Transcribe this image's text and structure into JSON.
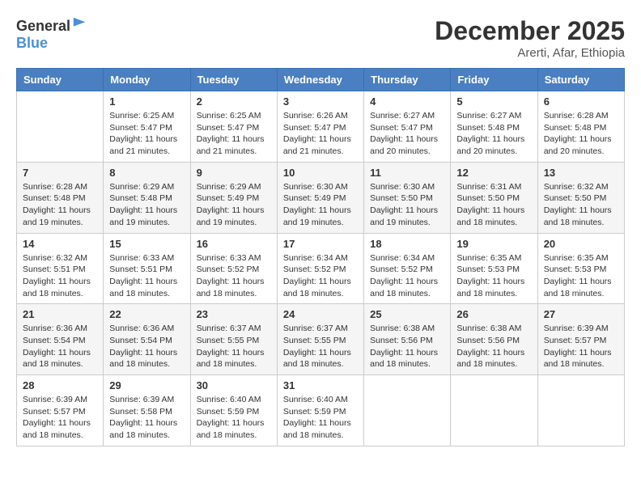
{
  "header": {
    "logo_general": "General",
    "logo_blue": "Blue",
    "month_year": "December 2025",
    "location": "Arerti, Afar, Ethiopia"
  },
  "weekdays": [
    "Sunday",
    "Monday",
    "Tuesday",
    "Wednesday",
    "Thursday",
    "Friday",
    "Saturday"
  ],
  "weeks": [
    [
      {
        "day": "",
        "info": ""
      },
      {
        "day": "1",
        "info": "Sunrise: 6:25 AM\nSunset: 5:47 PM\nDaylight: 11 hours and 21 minutes."
      },
      {
        "day": "2",
        "info": "Sunrise: 6:25 AM\nSunset: 5:47 PM\nDaylight: 11 hours and 21 minutes."
      },
      {
        "day": "3",
        "info": "Sunrise: 6:26 AM\nSunset: 5:47 PM\nDaylight: 11 hours and 21 minutes."
      },
      {
        "day": "4",
        "info": "Sunrise: 6:27 AM\nSunset: 5:47 PM\nDaylight: 11 hours and 20 minutes."
      },
      {
        "day": "5",
        "info": "Sunrise: 6:27 AM\nSunset: 5:48 PM\nDaylight: 11 hours and 20 minutes."
      },
      {
        "day": "6",
        "info": "Sunrise: 6:28 AM\nSunset: 5:48 PM\nDaylight: 11 hours and 20 minutes."
      }
    ],
    [
      {
        "day": "7",
        "info": "Sunrise: 6:28 AM\nSunset: 5:48 PM\nDaylight: 11 hours and 19 minutes."
      },
      {
        "day": "8",
        "info": "Sunrise: 6:29 AM\nSunset: 5:48 PM\nDaylight: 11 hours and 19 minutes."
      },
      {
        "day": "9",
        "info": "Sunrise: 6:29 AM\nSunset: 5:49 PM\nDaylight: 11 hours and 19 minutes."
      },
      {
        "day": "10",
        "info": "Sunrise: 6:30 AM\nSunset: 5:49 PM\nDaylight: 11 hours and 19 minutes."
      },
      {
        "day": "11",
        "info": "Sunrise: 6:30 AM\nSunset: 5:50 PM\nDaylight: 11 hours and 19 minutes."
      },
      {
        "day": "12",
        "info": "Sunrise: 6:31 AM\nSunset: 5:50 PM\nDaylight: 11 hours and 18 minutes."
      },
      {
        "day": "13",
        "info": "Sunrise: 6:32 AM\nSunset: 5:50 PM\nDaylight: 11 hours and 18 minutes."
      }
    ],
    [
      {
        "day": "14",
        "info": "Sunrise: 6:32 AM\nSunset: 5:51 PM\nDaylight: 11 hours and 18 minutes."
      },
      {
        "day": "15",
        "info": "Sunrise: 6:33 AM\nSunset: 5:51 PM\nDaylight: 11 hours and 18 minutes."
      },
      {
        "day": "16",
        "info": "Sunrise: 6:33 AM\nSunset: 5:52 PM\nDaylight: 11 hours and 18 minutes."
      },
      {
        "day": "17",
        "info": "Sunrise: 6:34 AM\nSunset: 5:52 PM\nDaylight: 11 hours and 18 minutes."
      },
      {
        "day": "18",
        "info": "Sunrise: 6:34 AM\nSunset: 5:52 PM\nDaylight: 11 hours and 18 minutes."
      },
      {
        "day": "19",
        "info": "Sunrise: 6:35 AM\nSunset: 5:53 PM\nDaylight: 11 hours and 18 minutes."
      },
      {
        "day": "20",
        "info": "Sunrise: 6:35 AM\nSunset: 5:53 PM\nDaylight: 11 hours and 18 minutes."
      }
    ],
    [
      {
        "day": "21",
        "info": "Sunrise: 6:36 AM\nSunset: 5:54 PM\nDaylight: 11 hours and 18 minutes."
      },
      {
        "day": "22",
        "info": "Sunrise: 6:36 AM\nSunset: 5:54 PM\nDaylight: 11 hours and 18 minutes."
      },
      {
        "day": "23",
        "info": "Sunrise: 6:37 AM\nSunset: 5:55 PM\nDaylight: 11 hours and 18 minutes."
      },
      {
        "day": "24",
        "info": "Sunrise: 6:37 AM\nSunset: 5:55 PM\nDaylight: 11 hours and 18 minutes."
      },
      {
        "day": "25",
        "info": "Sunrise: 6:38 AM\nSunset: 5:56 PM\nDaylight: 11 hours and 18 minutes."
      },
      {
        "day": "26",
        "info": "Sunrise: 6:38 AM\nSunset: 5:56 PM\nDaylight: 11 hours and 18 minutes."
      },
      {
        "day": "27",
        "info": "Sunrise: 6:39 AM\nSunset: 5:57 PM\nDaylight: 11 hours and 18 minutes."
      }
    ],
    [
      {
        "day": "28",
        "info": "Sunrise: 6:39 AM\nSunset: 5:57 PM\nDaylight: 11 hours and 18 minutes."
      },
      {
        "day": "29",
        "info": "Sunrise: 6:39 AM\nSunset: 5:58 PM\nDaylight: 11 hours and 18 minutes."
      },
      {
        "day": "30",
        "info": "Sunrise: 6:40 AM\nSunset: 5:59 PM\nDaylight: 11 hours and 18 minutes."
      },
      {
        "day": "31",
        "info": "Sunrise: 6:40 AM\nSunset: 5:59 PM\nDaylight: 11 hours and 18 minutes."
      },
      {
        "day": "",
        "info": ""
      },
      {
        "day": "",
        "info": ""
      },
      {
        "day": "",
        "info": ""
      }
    ]
  ]
}
